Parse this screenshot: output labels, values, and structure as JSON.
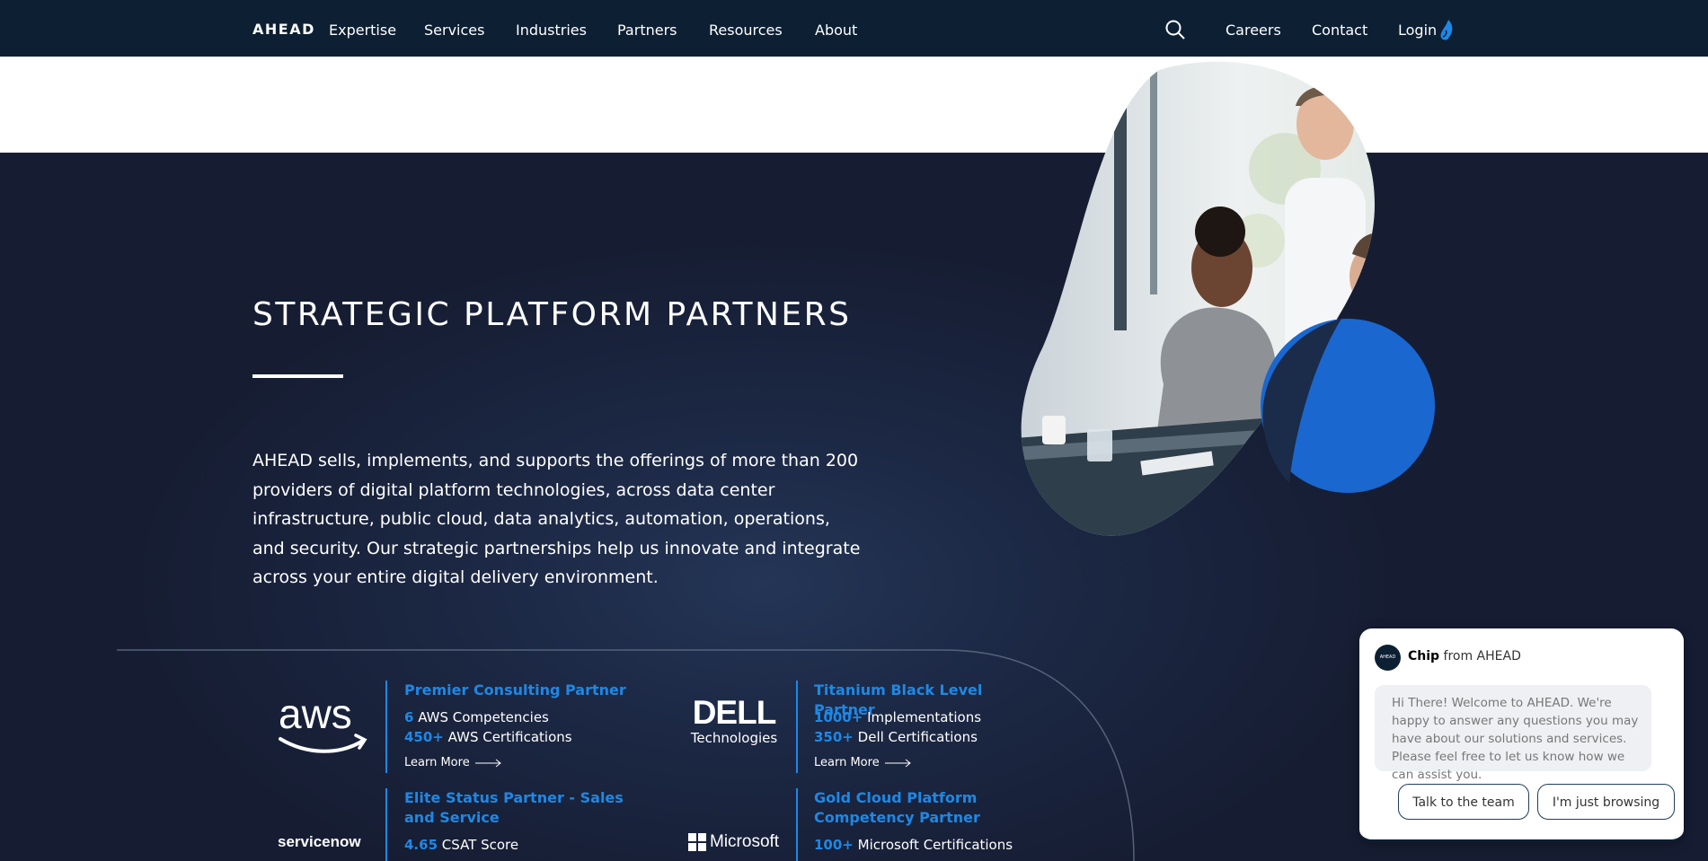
{
  "nav": {
    "logo": "AHEAD",
    "items": [
      "Expertise",
      "Services",
      "Industries",
      "Partners",
      "Resources",
      "About"
    ],
    "right_items": [
      "Careers",
      "Contact",
      "Login"
    ]
  },
  "hero": {
    "title": "STRATEGIC PLATFORM PARTNERS",
    "body": "AHEAD sells, implements, and supports the offerings of more than 200 providers of digital platform technologies, across data center infrastructure, public cloud, data analytics, automation, operations, and security. Our strategic partnerships help us innovate and integrate across your entire digital delivery environment."
  },
  "partners": [
    {
      "logo": "aws",
      "heading": "Premier Consulting Partner",
      "lines": [
        {
          "num": "6",
          "text": "AWS Competencies"
        },
        {
          "num": "450+",
          "text": "AWS Certifications"
        }
      ],
      "learn_more": "Learn More"
    },
    {
      "logo": "DELL Technologies",
      "logo_top": "DELL",
      "logo_bottom": "Technologies",
      "heading": "Titanium Black Level Partner",
      "lines": [
        {
          "num": "1000+",
          "text": "Implementations"
        },
        {
          "num": "350+",
          "text": "Dell Certifications"
        }
      ],
      "learn_more": "Learn More"
    },
    {
      "logo": "servicenow",
      "heading": "Elite Status Partner - Sales and Service",
      "lines": [
        {
          "num": "4.65",
          "text": "CSAT Score"
        }
      ]
    },
    {
      "logo": "Microsoft",
      "heading": "Gold Cloud Platform Competency Partner",
      "lines": [
        {
          "num": "100+",
          "text": "Microsoft Certifications"
        }
      ]
    }
  ],
  "chat": {
    "avatar_text": "AHEAD",
    "agent_name": "Chip",
    "from_text": " from AHEAD",
    "message": "Hi There! Welcome to AHEAD. We're happy to answer any questions you may have about our solutions and services. Please feel free to let us know how we can assist you.",
    "buttons": [
      "Talk to the team",
      "I'm just browsing"
    ]
  },
  "colors": {
    "nav_bg": "#0d1f33",
    "accent": "#1e88e5",
    "section_bg": "#1c2844"
  }
}
